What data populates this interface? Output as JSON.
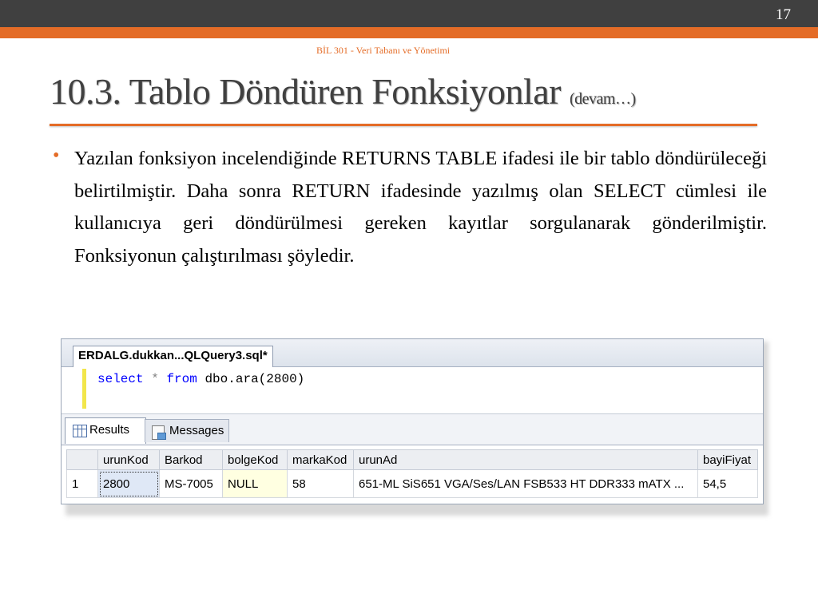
{
  "header": {
    "slide_number": "17",
    "course": "BİL 301 - Veri Tabanı ve Yönetimi"
  },
  "title": {
    "main": "10.3. Tablo Döndüren Fonksiyonlar",
    "subtitle": "(devam…)"
  },
  "bullet": {
    "marker": "•",
    "text": "Yazılan fonksiyon incelendiğinde RETURNS TABLE ifadesi ile bir tablo döndürüleceği belirtilmiştir. Daha sonra RETURN ifadesinde yazılmış olan SELECT cümlesi ile kullanıcıya geri döndürülmesi gereken kayıtlar sorgulanarak gönderilmiştir. Fonksiyonun çalıştırılması şöyledir."
  },
  "screenshot": {
    "doc_tab": "ERDALG.dukkan...QLQuery3.sql*",
    "query": {
      "kw_select": "select",
      "star": "*",
      "kw_from": "from",
      "rest": "dbo.ara(2800)"
    },
    "tabs": {
      "results": "Results",
      "messages": "Messages"
    },
    "columns": [
      "",
      "urunKod",
      "Barkod",
      "bolgeKod",
      "markaKod",
      "urunAd",
      "bayiFiyat"
    ],
    "rows": [
      [
        "1",
        "2800",
        "MS-7005",
        "NULL",
        "58",
        "651-ML SiS651 VGA/Ses/LAN FSB533 HT DDR333 mATX ...",
        "54,5"
      ]
    ]
  },
  "colors": {
    "accent": "#e46c27",
    "dark_bar": "#404040"
  }
}
